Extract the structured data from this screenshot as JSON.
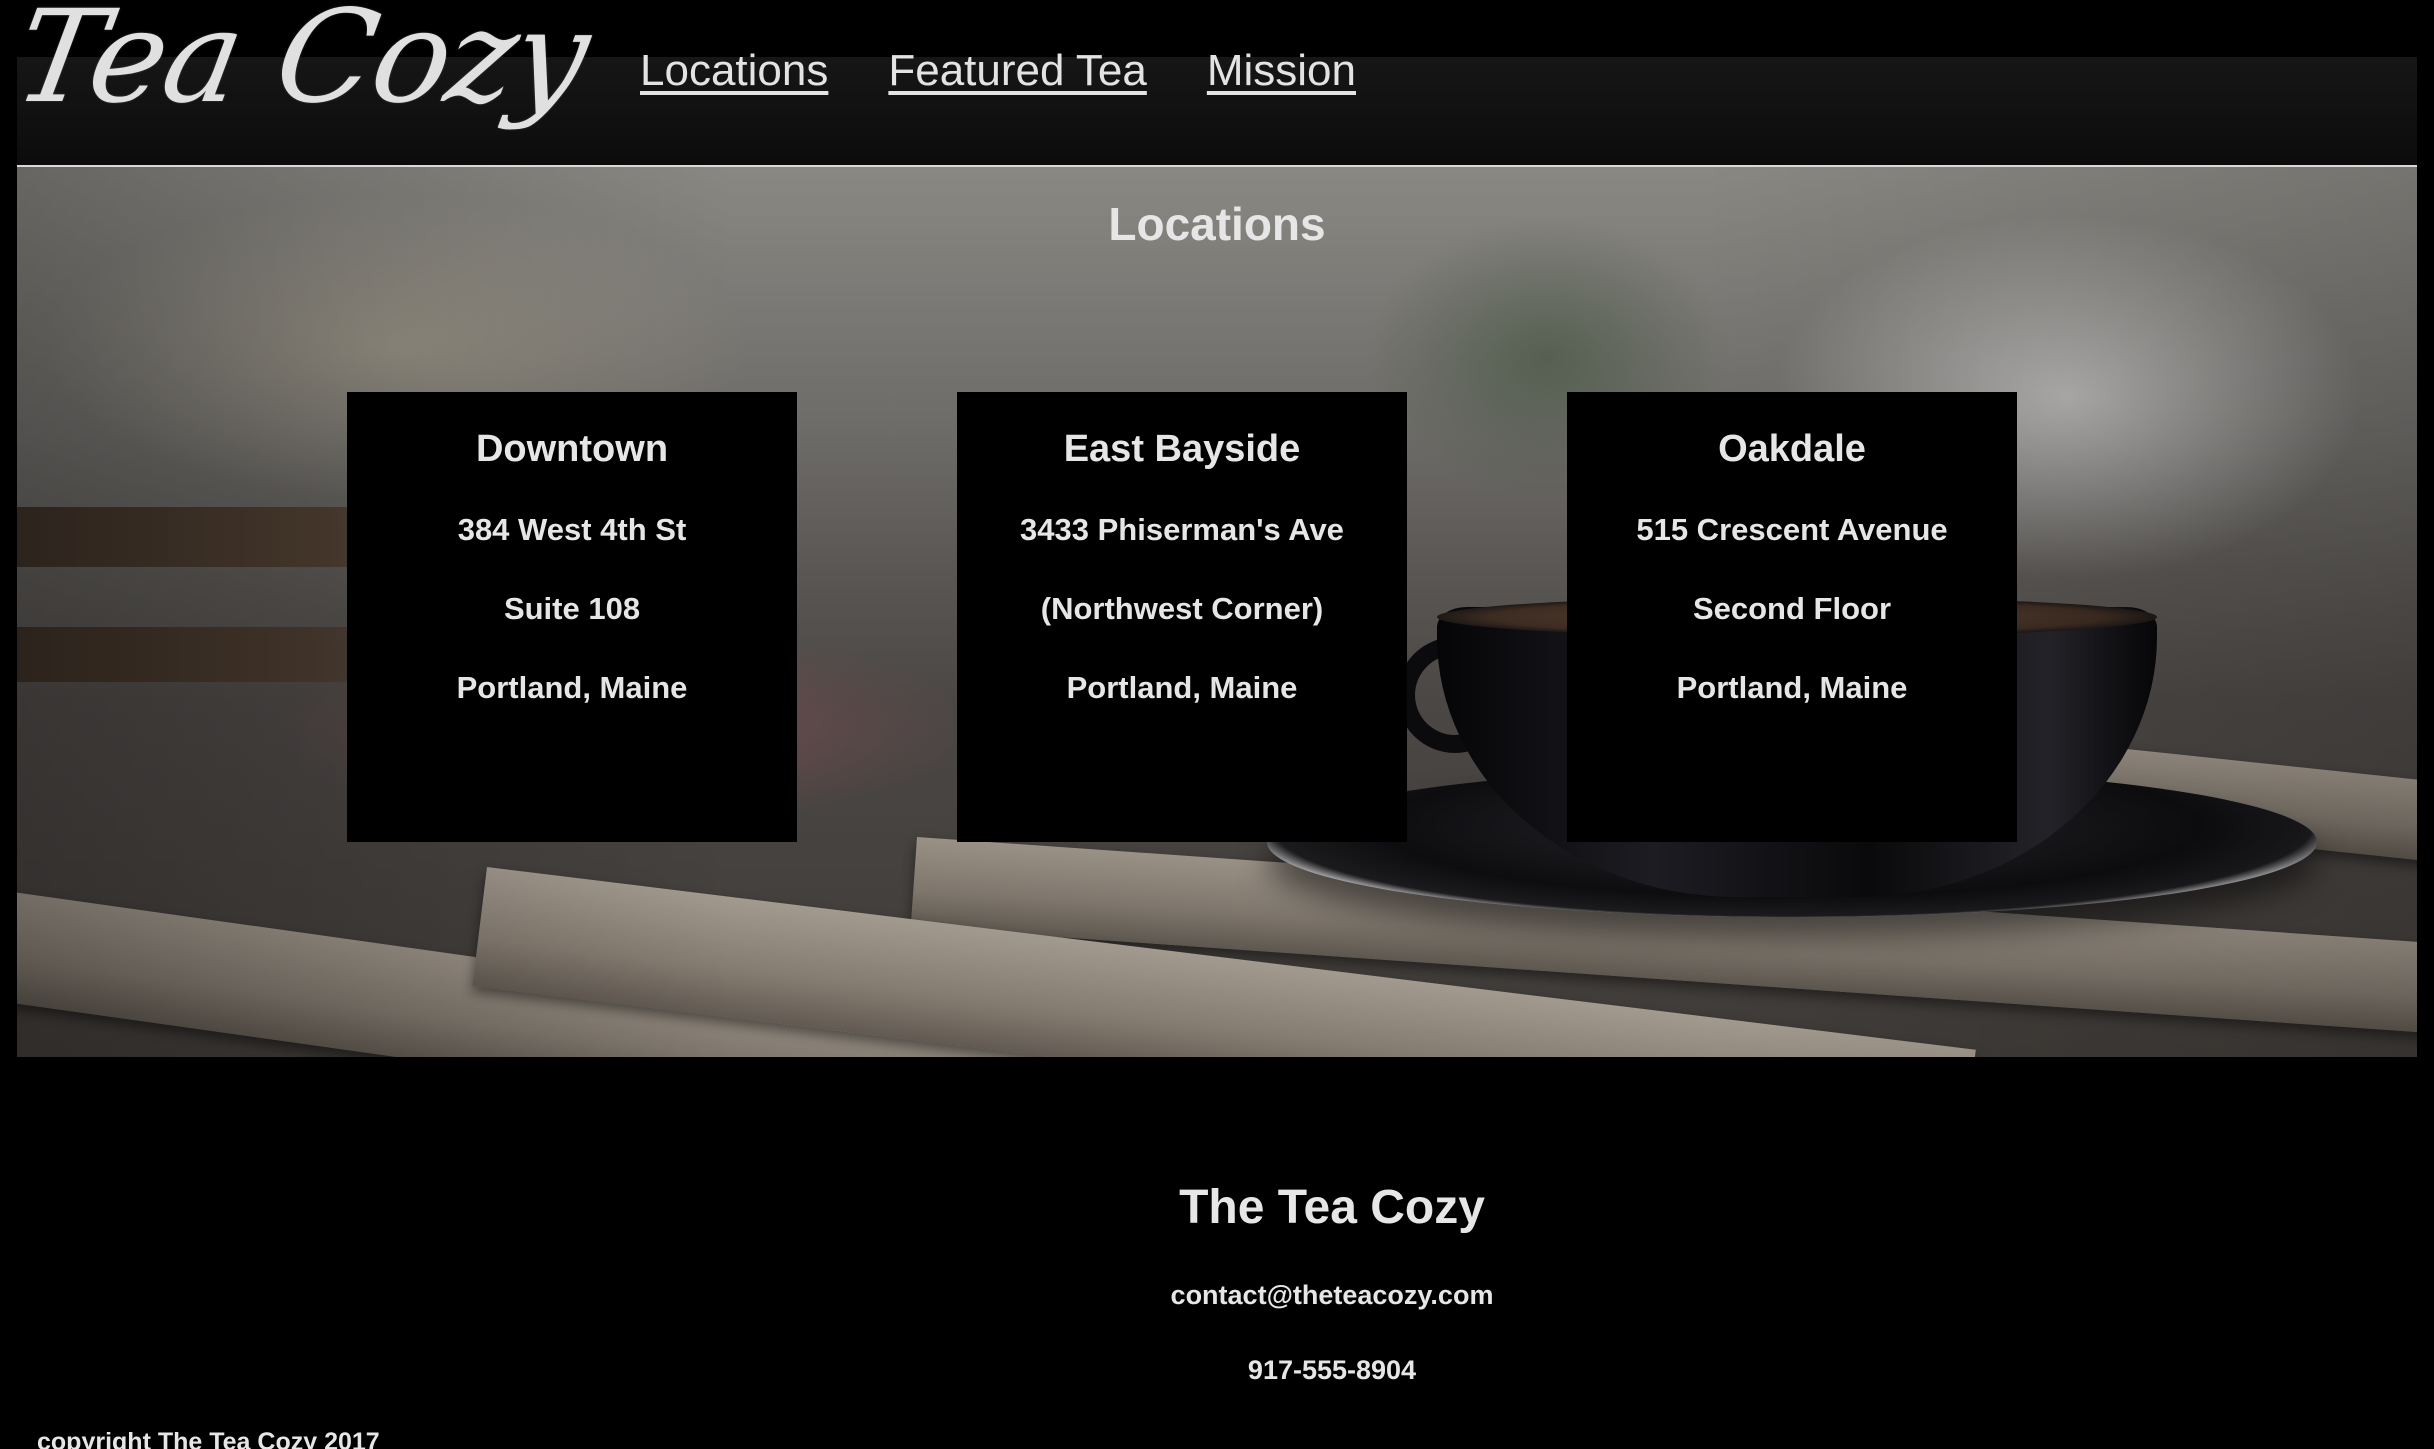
{
  "header": {
    "logo": "Tea Cozy",
    "nav": [
      {
        "label": "Locations"
      },
      {
        "label": "Featured Tea"
      },
      {
        "label": "Mission"
      }
    ]
  },
  "locations": {
    "title": "Locations",
    "cards": [
      {
        "name": "Downtown",
        "lines": [
          "384 West 4th St",
          "Suite 108",
          "Portland, Maine"
        ]
      },
      {
        "name": "East Bayside",
        "lines": [
          "3433 Phiserman's Ave",
          "(Northwest Corner)",
          "Portland, Maine"
        ]
      },
      {
        "name": "Oakdale",
        "lines": [
          "515 Crescent Avenue",
          "Second Floor",
          "Portland, Maine"
        ]
      }
    ]
  },
  "footer": {
    "title": "The Tea Cozy",
    "email": "contact@theteacozy.com",
    "phone": "917-555-8904",
    "copyright": "copyright The Tea Cozy 2017"
  },
  "colors": {
    "background": "#000000",
    "text": "#e6e6e6"
  }
}
